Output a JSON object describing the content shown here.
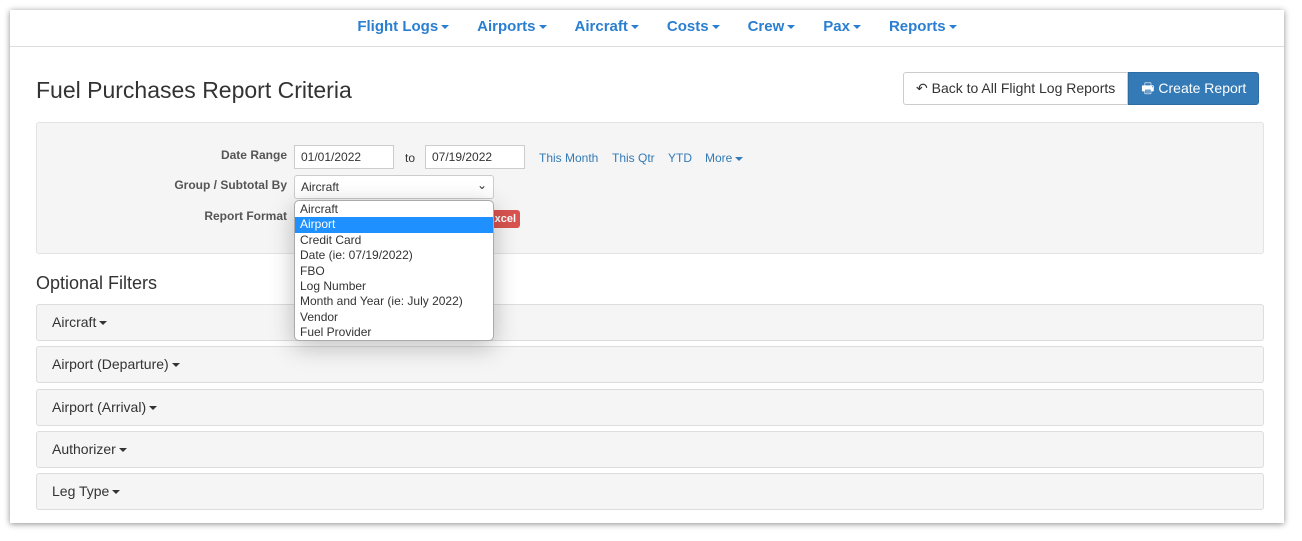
{
  "nav": [
    "Flight Logs",
    "Airports",
    "Aircraft",
    "Costs",
    "Crew",
    "Pax",
    "Reports"
  ],
  "page_title": "Fuel Purchases Report Criteria",
  "buttons": {
    "back": "Back to All Flight Log Reports",
    "create": "Create Report"
  },
  "criteria": {
    "date_range_label": "Date Range",
    "date_from": "01/01/2022",
    "to_label": "to",
    "date_to": "07/19/2022",
    "quick_links": [
      "This Month",
      "This Qtr",
      "YTD",
      "More"
    ],
    "group_label": "Group / Subtotal By",
    "group_value": "Aircraft",
    "group_options": [
      "Aircraft",
      "Airport",
      "Credit Card",
      "Date (ie: 07/19/2022)",
      "FBO",
      "Log Number",
      "Month and Year (ie: July 2022)",
      "Vendor",
      "Fuel Provider"
    ],
    "group_highlighted": "Airport",
    "format_label": "Report Format",
    "format_excel": "Excel"
  },
  "optional_filters": {
    "title": "Optional Filters",
    "items": [
      "Aircraft",
      "Airport (Departure)",
      "Airport (Arrival)",
      "Authorizer",
      "Leg Type"
    ]
  },
  "colors": {
    "accent": "#337ab7",
    "nav": "#2a7fd0",
    "excel": "#d9534f",
    "highlight": "#1e90ff"
  }
}
